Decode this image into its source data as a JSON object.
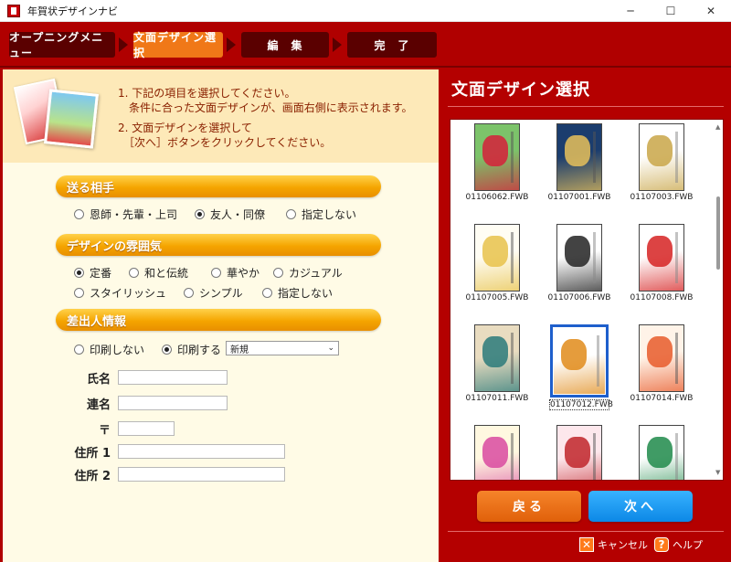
{
  "window": {
    "title": "年賀状デザインナビ",
    "minimize": "─",
    "maximize": "☐",
    "close": "✕"
  },
  "steps": [
    {
      "label": "オープニングメニュー"
    },
    {
      "label": "文面デザイン選択"
    },
    {
      "label": "編　集"
    },
    {
      "label": "完　了"
    }
  ],
  "intro": {
    "line1": "1. 下記の項目を選択してください。",
    "line2": "　条件に合った文面デザインが、画面右側に表示されます。",
    "line3": "2. 文面デザインを選択して",
    "line4": "　［次へ］ボタンをクリックしてください。"
  },
  "recipient": {
    "header": "送る相手",
    "options": [
      {
        "label": "恩師・先輩・上司",
        "selected": false
      },
      {
        "label": "友人・同僚",
        "selected": true
      },
      {
        "label": "指定しない",
        "selected": false
      }
    ]
  },
  "atmosphere": {
    "header": "デザインの雰囲気",
    "options": [
      {
        "label": "定番",
        "selected": true
      },
      {
        "label": "和と伝統",
        "selected": false
      },
      {
        "label": "華やか",
        "selected": false
      },
      {
        "label": "カジュアル",
        "selected": false
      },
      {
        "label": "スタイリッシュ",
        "selected": false
      },
      {
        "label": "シンプル",
        "selected": false
      },
      {
        "label": "指定しない",
        "selected": false
      }
    ]
  },
  "sender": {
    "header": "差出人情報",
    "print_no": "印刷しない",
    "print_yes": "印刷する",
    "print_selected": "yes",
    "select_value": "新規",
    "fields": {
      "name_label": "氏名",
      "joint_label": "連名",
      "postal_label": "〒",
      "address1_label": "住所 1",
      "address2_label": "住所 2"
    }
  },
  "right": {
    "title": "文面デザイン選択",
    "thumbnails": [
      {
        "file": "01106062.FWB",
        "colors": [
          "#7cc36a",
          "#d6203a"
        ],
        "selected": false
      },
      {
        "file": "01107001.FWB",
        "colors": [
          "#1b3d6e",
          "#e8c15a"
        ],
        "selected": false
      },
      {
        "file": "01107003.FWB",
        "colors": [
          "#ffffff",
          "#c9a648"
        ],
        "selected": false
      },
      {
        "file": "01107005.FWB",
        "colors": [
          "#fffdf4",
          "#e7c24a"
        ],
        "selected": false
      },
      {
        "file": "01107006.FWB",
        "colors": [
          "#ffffff",
          "#222222"
        ],
        "selected": false
      },
      {
        "file": "01107008.FWB",
        "colors": [
          "#ffffff",
          "#d62222"
        ],
        "selected": false
      },
      {
        "file": "01107011.FWB",
        "colors": [
          "#e9dcc0",
          "#2a7a7a"
        ],
        "selected": false
      },
      {
        "file": "01107012.FWB",
        "colors": [
          "#ffffff",
          "#e08b1a"
        ],
        "selected": true
      },
      {
        "file": "01107014.FWB",
        "colors": [
          "#fff3e8",
          "#e85a2a"
        ],
        "selected": false
      },
      {
        "file": "",
        "colors": [
          "#fff8e0",
          "#d94aa0"
        ],
        "selected": false
      },
      {
        "file": "",
        "colors": [
          "#fde7ec",
          "#c0242a"
        ],
        "selected": false
      },
      {
        "file": "",
        "colors": [
          "#ffffff",
          "#1f8a4a"
        ],
        "selected": false
      }
    ],
    "back_label": "戻る",
    "next_label": "次へ",
    "cancel_label": "キャンセル",
    "help_label": "ヘルプ",
    "cancel_icon": "✕",
    "help_icon": "?"
  }
}
